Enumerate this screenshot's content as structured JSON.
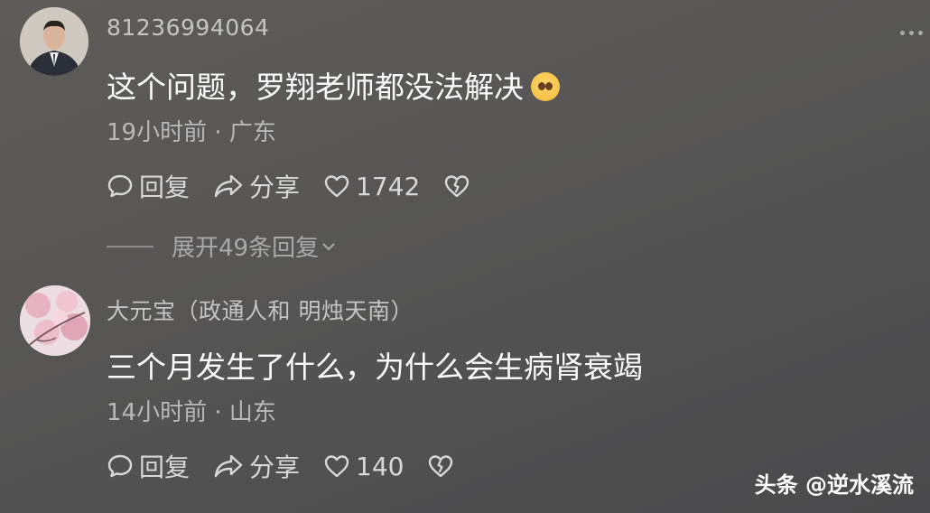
{
  "comments": [
    {
      "username": "81236994064",
      "text": "这个问题，罗翔老师都没法解决",
      "meta": "19小时前 · 广东",
      "reply_label": "回复",
      "share_label": "分享",
      "likes": "1742",
      "expand_label": "展开49条回复"
    },
    {
      "username": "大元宝（政通人和 明烛天南）",
      "text": "三个月发生了什么，为什么会生病肾衰竭",
      "meta": "14小时前 · 山东",
      "reply_label": "回复",
      "share_label": "分享",
      "likes": "140"
    }
  ],
  "watermark": "头条 @逆水溪流",
  "icons": {
    "avatar_1": "man-in-suit-avatar",
    "avatar_2": "pink-blossom-avatar",
    "emoji": "pleading-face-emoji",
    "reply": "chat-bubble-icon",
    "share": "share-arrow-icon",
    "like": "heart-icon",
    "dislike": "broken-heart-icon",
    "expand": "chevron-down-icon",
    "more": "more-dots-icon"
  }
}
